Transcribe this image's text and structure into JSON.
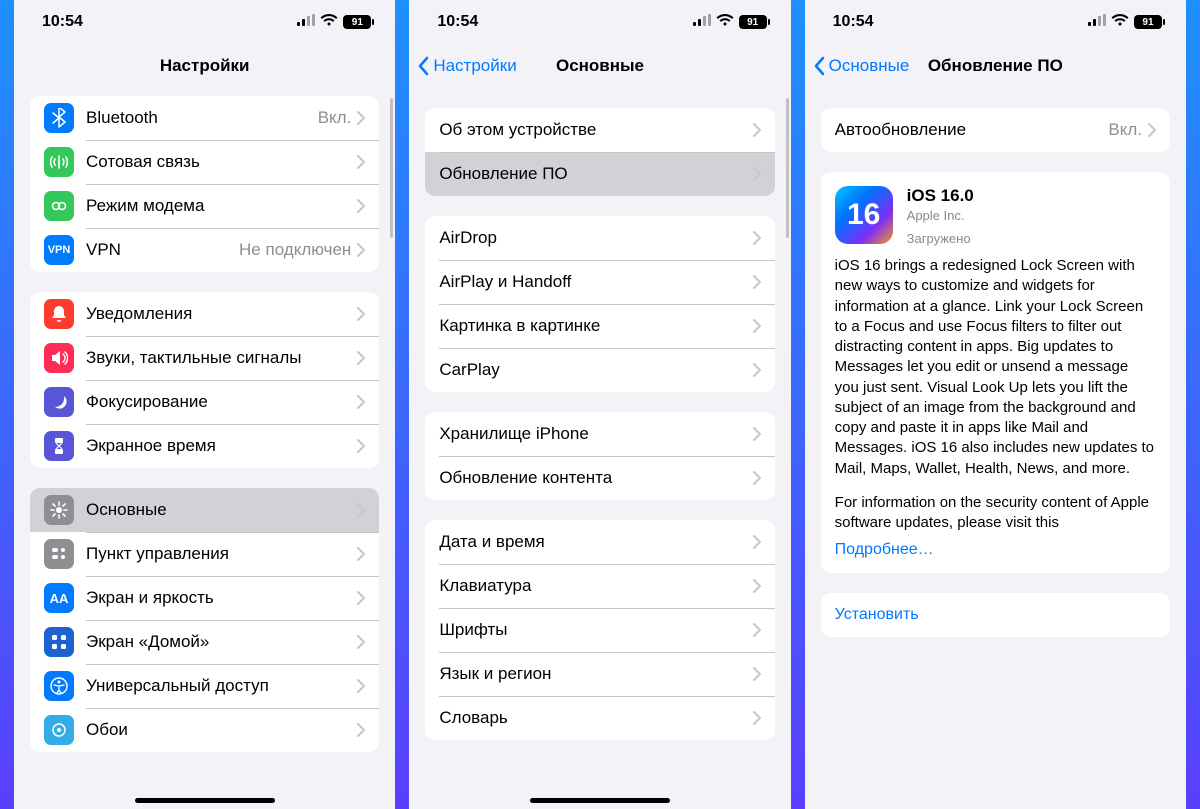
{
  "status": {
    "time": "10:54",
    "battery": "91"
  },
  "panel1": {
    "title": "Настройки",
    "groups": [
      {
        "rows": [
          {
            "icon": "bluetooth-icon",
            "bg": "bg-blue",
            "glyph": "B",
            "label": "Bluetooth",
            "value": "Вкл."
          },
          {
            "icon": "cellular-icon",
            "bg": "bg-green",
            "glyph": "A",
            "label": "Сотовая связь"
          },
          {
            "icon": "hotspot-icon",
            "bg": "bg-green",
            "glyph": "H",
            "label": "Режим модема"
          },
          {
            "icon": "vpn-icon",
            "bg": "bg-blue",
            "glyph": "VPN",
            "label": "VPN",
            "value": "Не подключен"
          }
        ]
      },
      {
        "rows": [
          {
            "icon": "notifications-icon",
            "bg": "bg-red",
            "glyph": "N",
            "label": "Уведомления"
          },
          {
            "icon": "sounds-icon",
            "bg": "bg-red2",
            "glyph": "S",
            "label": "Звуки, тактильные сигналы"
          },
          {
            "icon": "focus-icon",
            "bg": "bg-indigo",
            "glyph": "F",
            "label": "Фокусирование"
          },
          {
            "icon": "screentime-icon",
            "bg": "bg-indigo",
            "glyph": "T",
            "label": "Экранное время"
          }
        ]
      },
      {
        "rows": [
          {
            "icon": "general-icon",
            "bg": "bg-gray",
            "glyph": "G",
            "label": "Основные",
            "selected": true
          },
          {
            "icon": "control-center-icon",
            "bg": "bg-gray",
            "glyph": "C",
            "label": "Пункт управления"
          },
          {
            "icon": "display-icon",
            "bg": "bg-blue",
            "glyph": "AA",
            "label": "Экран и яркость"
          },
          {
            "icon": "home-screen-icon",
            "bg": "bg-darkblue",
            "glyph": "H",
            "label": "Экран «Домой»"
          },
          {
            "icon": "accessibility-icon",
            "bg": "bg-blue",
            "glyph": "U",
            "label": "Универсальный доступ"
          },
          {
            "icon": "wallpaper-icon",
            "bg": "bg-cyan",
            "glyph": "W",
            "label": "Обои"
          }
        ]
      }
    ]
  },
  "panel2": {
    "back": "Настройки",
    "title": "Основные",
    "groups": [
      [
        {
          "label": "Об этом устройстве"
        },
        {
          "label": "Обновление ПО",
          "selected": true
        }
      ],
      [
        {
          "label": "AirDrop"
        },
        {
          "label": "AirPlay и Handoff"
        },
        {
          "label": "Картинка в картинке"
        },
        {
          "label": "CarPlay"
        }
      ],
      [
        {
          "label": "Хранилище iPhone"
        },
        {
          "label": "Обновление контента"
        }
      ],
      [
        {
          "label": "Дата и время"
        },
        {
          "label": "Клавиатура"
        },
        {
          "label": "Шрифты"
        },
        {
          "label": "Язык и регион"
        },
        {
          "label": "Словарь"
        }
      ]
    ]
  },
  "panel3": {
    "back": "Основные",
    "title": "Обновление ПО",
    "auto_label": "Автообновление",
    "auto_value": "Вкл.",
    "update": {
      "badge": "16",
      "name": "iOS 16.0",
      "vendor": "Apple Inc.",
      "state": "Загружено",
      "desc1": "iOS 16 brings a redesigned Lock Screen with new ways to customize and widgets for information at a glance. Link your Lock Screen to a Focus and use Focus filters to filter out distracting content in apps. Big updates to Messages let you edit or unsend a message you just sent. Visual Look Up lets you lift the subject of an image from the background and copy and paste it in apps like Mail and Messages. iOS 16 also includes new updates to Mail, Maps, Wallet, Health, News, and more.",
      "desc2": "For information on the security content of Apple software updates, please visit this",
      "more": "Подробнее…"
    },
    "install": "Установить"
  }
}
